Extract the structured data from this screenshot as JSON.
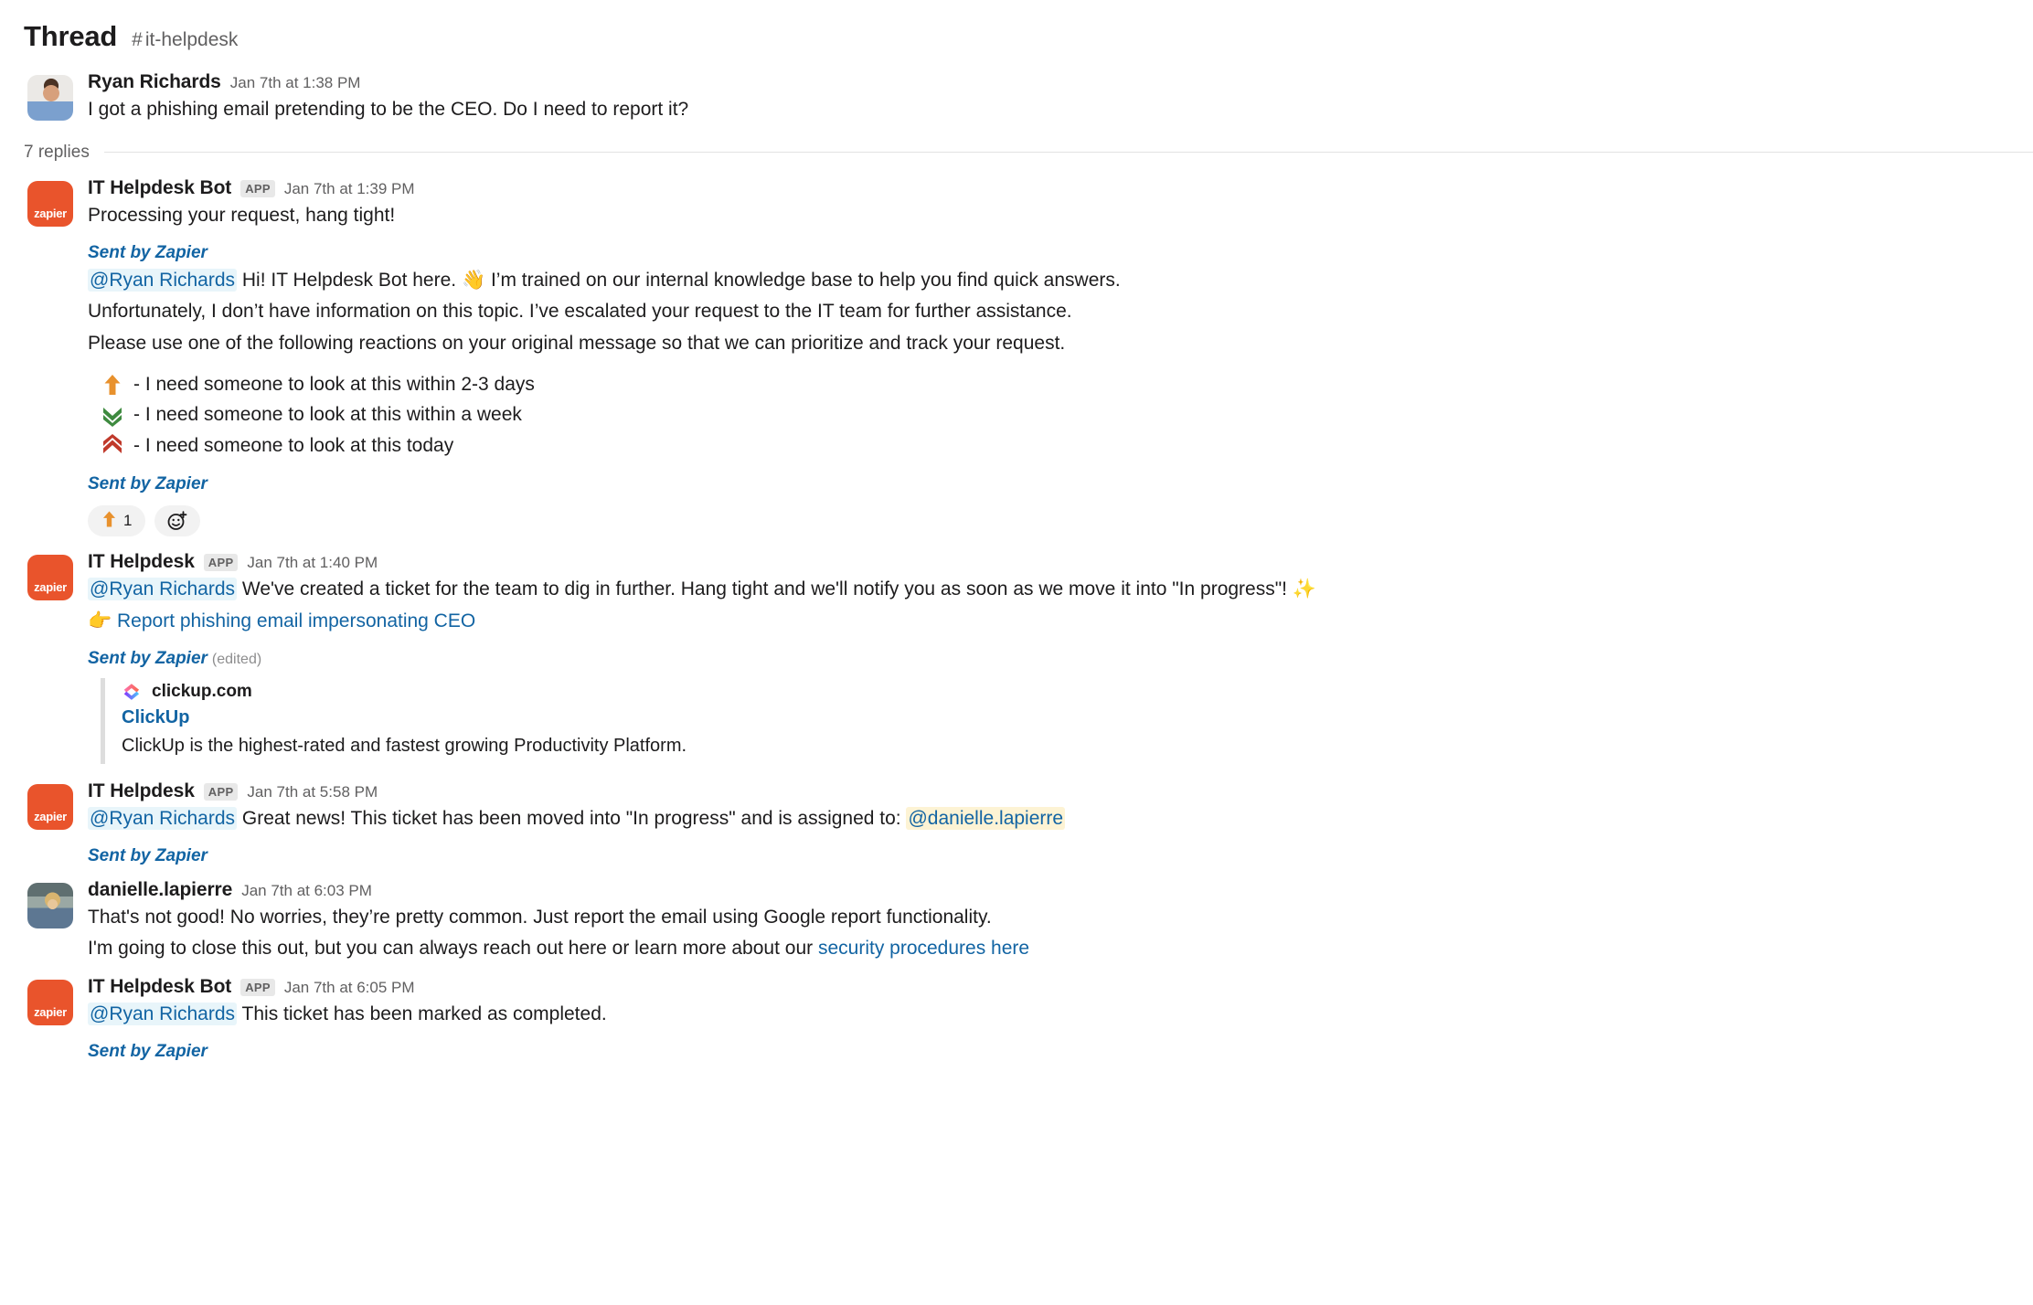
{
  "header": {
    "title": "Thread",
    "hash": "#",
    "channel": "it-helpdesk"
  },
  "root_message": {
    "author": "Ryan Richards",
    "timestamp": "Jan 7th at 1:38 PM",
    "text": "I got a phishing email pretending to be the CEO. Do I need to report it?",
    "avatar": "photo-avatar-ryan"
  },
  "replies_divider": {
    "label": "7 replies"
  },
  "messages": [
    {
      "author": "IT Helpdesk Bot",
      "badge": "APP",
      "timestamp": "Jan 7th at 1:39 PM",
      "avatar": "zapier-app-icon",
      "avatar_word": "zapier",
      "line1": "Processing your request, hang tight!",
      "footer1": "Sent by Zapier",
      "mention": "@Ryan Richards",
      "greeting": "Hi! IT Helpdesk Bot here.",
      "greeting_emoji": "👋",
      "greeting_tail": "I’m trained on our internal knowledge base to help you find quick answers.",
      "para2": "Unfortunately, I don’t have information on this topic. I’ve escalated your request to the IT team for further assistance.",
      "para3": "Please use one of the following reactions on your original message so that we can prioritize and track your request.",
      "priorities": [
        {
          "icon": "arrow-up-orange-icon",
          "text": "- I need someone to look at this within 2-3 days"
        },
        {
          "icon": "double-chevron-down-green-icon",
          "text": "- I need someone to look at this within a week"
        },
        {
          "icon": "double-chevron-up-red-icon",
          "text": "- I need someone to look at this today"
        }
      ],
      "footer2": "Sent by Zapier",
      "reaction": {
        "icon": "arrow-up-orange-icon",
        "count": "1"
      }
    },
    {
      "author": "IT Helpdesk",
      "badge": "APP",
      "timestamp": "Jan 7th at 1:40 PM",
      "avatar": "zapier-app-icon",
      "avatar_word": "zapier",
      "mention": "@Ryan Richards",
      "text": "We've created a ticket for the team to dig in further. Hang tight and we'll notify you as soon as we move it into \"In progress\"!",
      "text_emoji": "✨",
      "ticket_emoji": "👉",
      "ticket_link": "Report phishing email impersonating CEO",
      "footer": "Sent by Zapier",
      "edited": "(edited)",
      "unfurl": {
        "site": "clickup.com",
        "title": "ClickUp",
        "description": "ClickUp is the highest-rated and fastest growing Productivity Platform."
      }
    },
    {
      "author": "IT Helpdesk",
      "badge": "APP",
      "timestamp": "Jan 7th at 5:58 PM",
      "avatar": "zapier-app-icon",
      "avatar_word": "zapier",
      "mention": "@Ryan Richards",
      "text": "Great news! This ticket has been moved into \"In progress\" and is assigned to:",
      "assignee": "@danielle.lapierre",
      "footer": "Sent by Zapier"
    },
    {
      "author": "danielle.lapierre",
      "timestamp": "Jan 7th at 6:03 PM",
      "avatar": "photo-avatar-danielle",
      "para1": "That's not good! No worries, they’re pretty common. Just report the email using Google report functionality.",
      "para2_pre": "I'm going to close this out, but you can always reach out here or learn more about our ",
      "para2_link": "security procedures here"
    },
    {
      "author": "IT Helpdesk Bot",
      "badge": "APP",
      "timestamp": "Jan 7th at 6:05 PM",
      "avatar": "zapier-app-icon",
      "avatar_word": "zapier",
      "mention": "@Ryan Richards",
      "text": "This ticket has been marked as completed.",
      "footer": "Sent by Zapier"
    }
  ],
  "colors": {
    "zapier_orange": "#e9542c",
    "link_blue": "#1264a3",
    "mention_bg": "#e8f5fa",
    "assignee_bg": "#fdf3d4",
    "priority_orange": "#e8912d",
    "priority_green": "#3e8a3f",
    "priority_red": "#c0392b",
    "text": "#1d1c1d",
    "muted": "#616061"
  }
}
